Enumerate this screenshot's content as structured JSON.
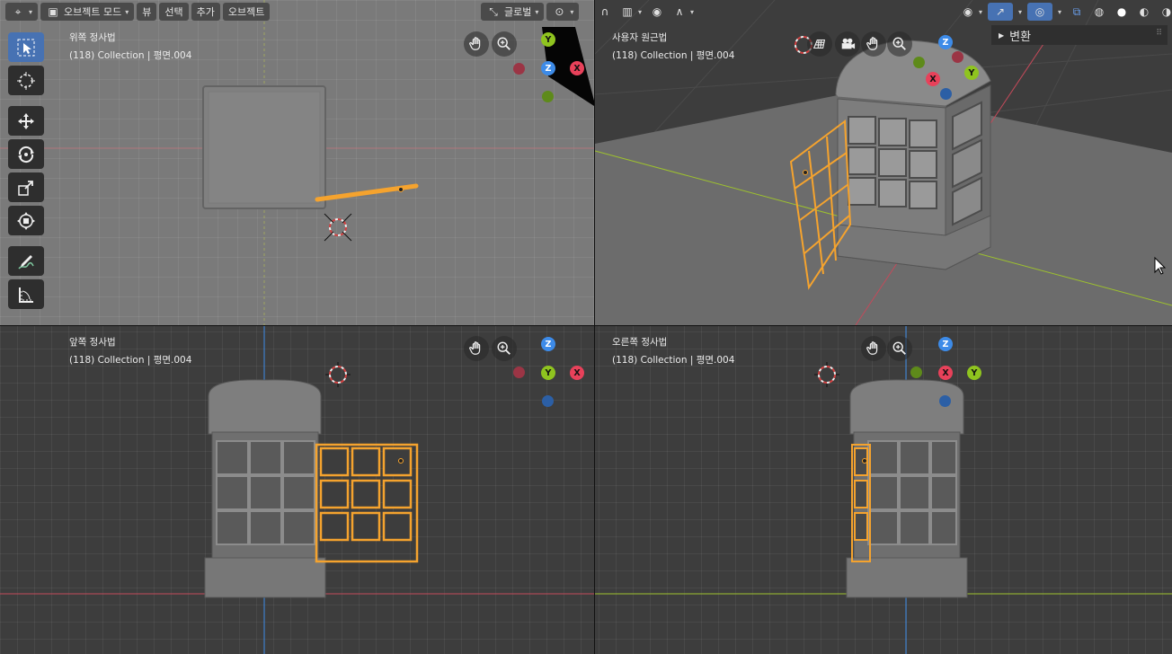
{
  "header": {
    "mode_label": "오브젝트 모드",
    "menu": [
      "뷰",
      "선택",
      "추가",
      "오브젝트"
    ],
    "orientation_label": "글로벌"
  },
  "viewports": {
    "top": {
      "name": "위쪽 정사법",
      "info": "(118) Collection | 평면.004"
    },
    "persp": {
      "name": "사용자 원근법",
      "info": "(118) Collection | 평면.004"
    },
    "front": {
      "name": "앞쪽 정사법",
      "info": "(118) Collection | 평면.004"
    },
    "right": {
      "name": "오른쪽 정사법",
      "info": "(118) Collection | 평면.004"
    }
  },
  "npanel": {
    "section": "변환"
  },
  "axes": {
    "x": "X",
    "y": "Y",
    "z": "Z"
  },
  "colors": {
    "accent": "#4772b3",
    "selection": "#f5a32e",
    "axis_x": "#e8415a",
    "axis_y": "#8fc41f",
    "axis_z": "#3d8be8"
  },
  "icons": {
    "toolbar": [
      "select-box-icon",
      "cursor-icon",
      "move-icon",
      "rotate-icon",
      "scale-icon",
      "transform-icon",
      "annotate-icon",
      "measure-icon"
    ],
    "nav": [
      "hand-pan-icon",
      "zoom-icon",
      "camera-icon",
      "grid-icon"
    ]
  }
}
